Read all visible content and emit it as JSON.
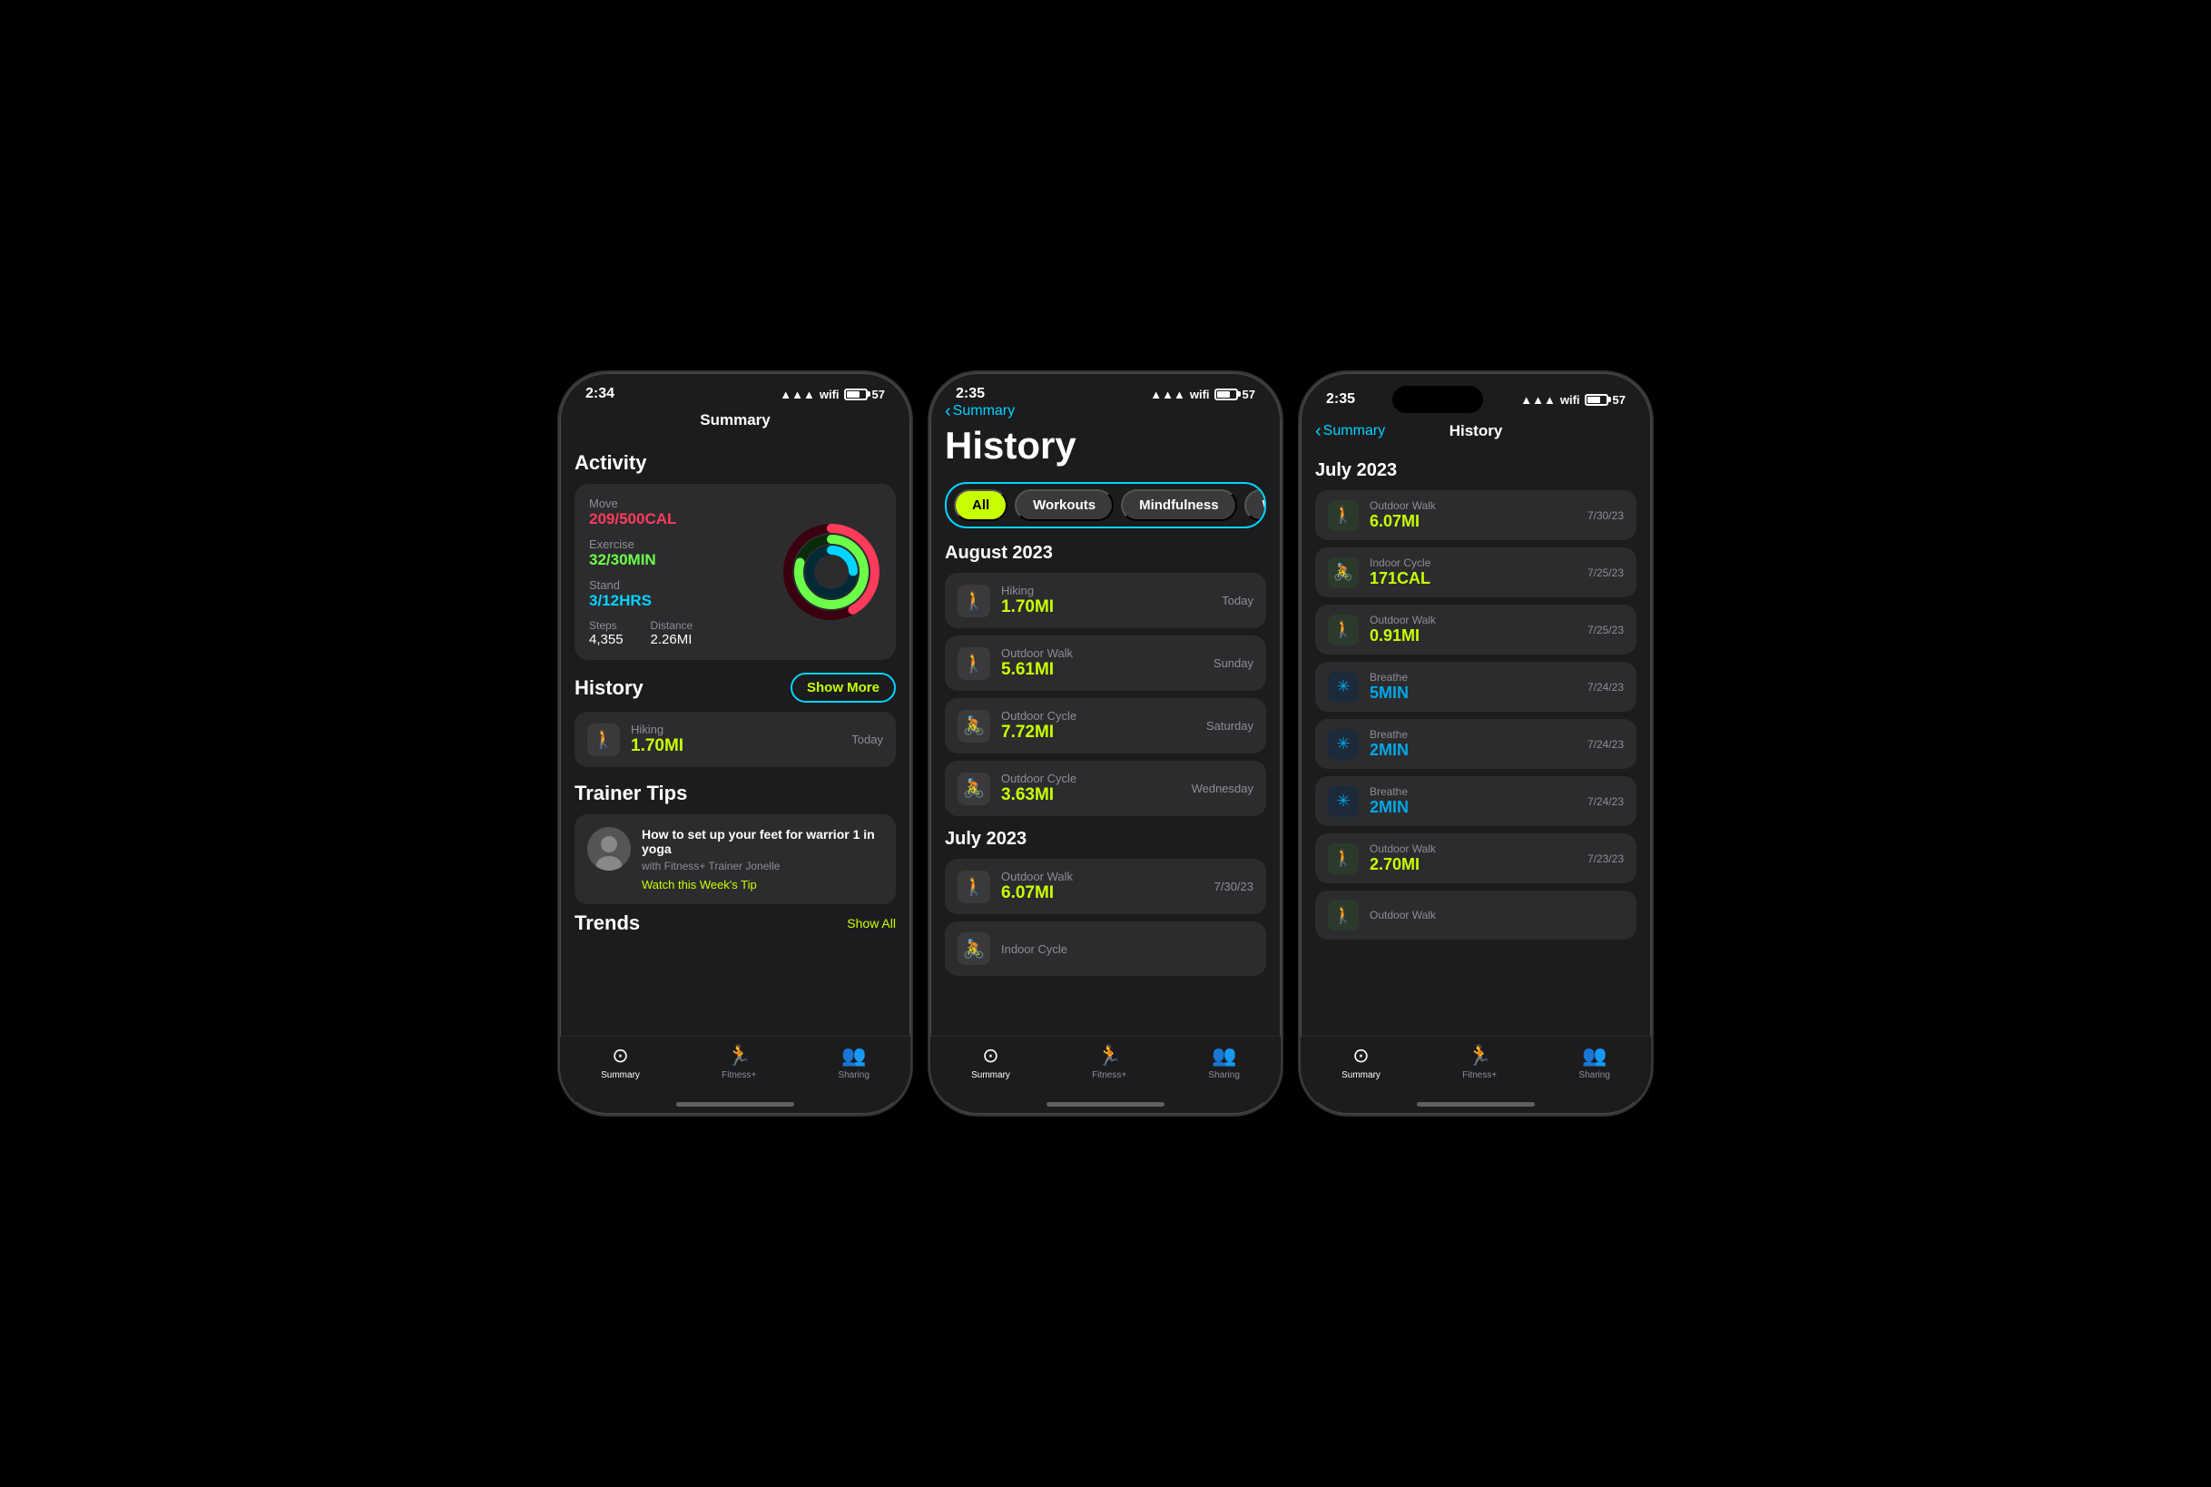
{
  "colors": {
    "move": "#ff3b5c",
    "exercise": "#6bff4a",
    "stand": "#00d4ff",
    "green_accent": "#c8ff00",
    "blue_accent": "#00d4ff",
    "bg_card": "#2c2c2e",
    "bg_phone": "#1c1c1e",
    "text_secondary": "#8e8e93"
  },
  "phones": [
    {
      "id": "phone1",
      "status_time": "2:34",
      "nav_title": "Summary",
      "sections": {
        "activity": {
          "title": "Activity",
          "move_label": "Move",
          "move_value": "209/500CAL",
          "exercise_label": "Exercise",
          "exercise_value": "32/30MIN",
          "stand_label": "Stand",
          "stand_value": "3/12HRS",
          "steps_label": "Steps",
          "steps_value": "4,355",
          "distance_label": "Distance",
          "distance_value": "2.26MI"
        },
        "history": {
          "title": "History",
          "show_more": "Show More",
          "item": {
            "type": "Hiking",
            "value": "1.70MI",
            "date": "Today"
          }
        },
        "trainer_tips": {
          "title": "Trainer Tips",
          "tip_title": "How to set up your feet for warrior 1 in yoga",
          "tip_sub": "with Fitness+ Trainer Jonelle",
          "link": "Watch this Week's Tip"
        },
        "trends": {
          "title": "Trends",
          "show": "Show All"
        }
      },
      "tab_bar": {
        "items": [
          {
            "label": "Summary",
            "active": true
          },
          {
            "label": "Fitness+",
            "active": false
          },
          {
            "label": "Sharing",
            "active": false
          }
        ]
      }
    },
    {
      "id": "phone2",
      "status_time": "2:35",
      "nav_back": "Summary",
      "page_title": "History",
      "filters": [
        "All",
        "Workouts",
        "Mindfulness",
        "W"
      ],
      "active_filter": "All",
      "sections": [
        {
          "month": "August 2023",
          "items": [
            {
              "type": "Hiking",
              "value": "1.70MI",
              "date": "Today",
              "icon": "walk"
            },
            {
              "type": "Outdoor Walk",
              "value": "5.61MI",
              "date": "Sunday",
              "icon": "walk"
            },
            {
              "type": "Outdoor Cycle",
              "value": "7.72MI",
              "date": "Saturday",
              "icon": "cycle"
            },
            {
              "type": "Outdoor Cycle",
              "value": "3.63MI",
              "date": "Wednesday",
              "icon": "cycle"
            }
          ]
        },
        {
          "month": "July 2023",
          "items": [
            {
              "type": "Outdoor Walk",
              "value": "6.07MI",
              "date": "7/30/23",
              "icon": "walk"
            },
            {
              "type": "Indoor Cycle",
              "value": "",
              "date": "",
              "icon": "cycle"
            }
          ]
        }
      ],
      "tab_bar": {
        "items": [
          {
            "label": "Summary",
            "active": true
          },
          {
            "label": "Fitness+",
            "active": false
          },
          {
            "label": "Sharing",
            "active": false
          }
        ]
      }
    },
    {
      "id": "phone3",
      "status_time": "2:35",
      "nav_back": "Summary",
      "nav_title": "History",
      "sections": [
        {
          "month": "July 2023",
          "items": [
            {
              "type": "Outdoor Walk",
              "value": "6.07MI",
              "date": "7/30/23",
              "icon": "walk"
            },
            {
              "type": "Indoor Cycle",
              "value": "171CAL",
              "date": "7/25/23",
              "icon": "cycle"
            },
            {
              "type": "Outdoor Walk",
              "value": "0.91MI",
              "date": "7/25/23",
              "icon": "walk"
            },
            {
              "type": "Breathe",
              "value": "5MIN",
              "date": "7/24/23",
              "icon": "breathe"
            },
            {
              "type": "Breathe",
              "value": "2MIN",
              "date": "7/24/23",
              "icon": "breathe"
            },
            {
              "type": "Breathe",
              "value": "2MIN",
              "date": "7/24/23",
              "icon": "breathe"
            },
            {
              "type": "Outdoor Walk",
              "value": "2.70MI",
              "date": "7/23/23",
              "icon": "walk"
            },
            {
              "type": "Outdoor Walk",
              "value": "",
              "date": "",
              "icon": "walk"
            }
          ]
        }
      ],
      "tab_bar": {
        "items": [
          {
            "label": "Summary",
            "active": true
          },
          {
            "label": "Fitness+",
            "active": false
          },
          {
            "label": "Sharing",
            "active": false
          }
        ]
      }
    }
  ]
}
